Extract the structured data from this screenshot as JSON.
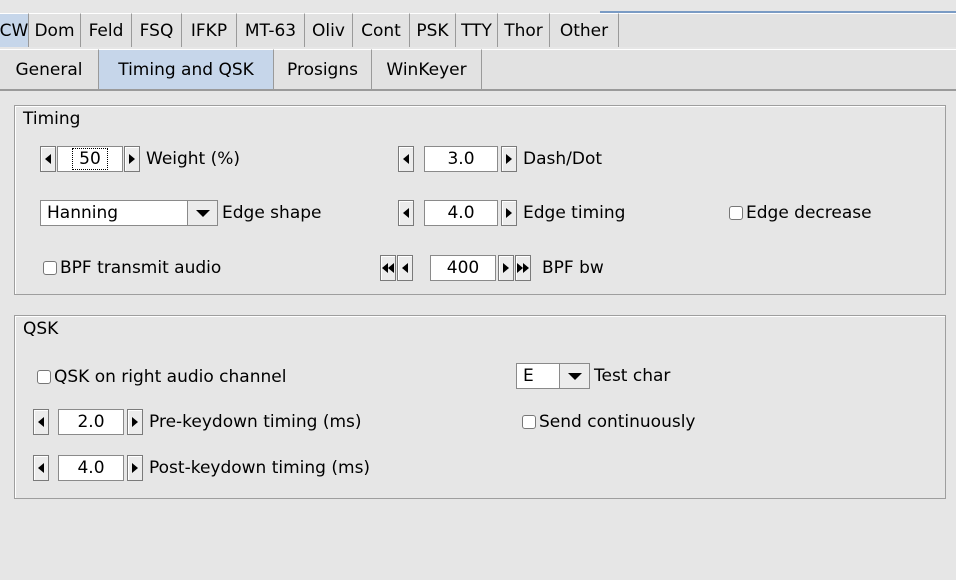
{
  "mode_tabs": [
    "CW",
    "Dom",
    "Feld",
    "FSQ",
    "IFKP",
    "MT-63",
    "Oliv",
    "Cont",
    "PSK",
    "TTY",
    "Thor",
    "Other"
  ],
  "sub_tabs": [
    "General",
    "Timing and QSK",
    "Prosigns",
    "WinKeyer"
  ],
  "timing": {
    "title": "Timing",
    "weight": {
      "value": "50",
      "label": "Weight (%)"
    },
    "dash_dot": {
      "value": "3.0",
      "label": "Dash/Dot"
    },
    "edge_shape": {
      "value": "Hanning",
      "label": "Edge shape"
    },
    "edge_timing": {
      "value": "4.0",
      "label": "Edge timing"
    },
    "edge_decrease": {
      "label": "Edge decrease",
      "checked": false
    },
    "bpf_transmit": {
      "label": "BPF transmit audio",
      "checked": false
    },
    "bpf_bw": {
      "value": "400",
      "label": "BPF bw"
    }
  },
  "qsk": {
    "title": "QSK",
    "right_channel": {
      "label": "QSK on right audio channel",
      "checked": false
    },
    "test_char": {
      "value": "E",
      "label": "Test char"
    },
    "pre_keydown": {
      "value": "2.0",
      "label": "Pre-keydown timing (ms)"
    },
    "send_continuously": {
      "label": "Send continuously",
      "checked": false
    },
    "post_keydown": {
      "value": "4.0",
      "label": "Post-keydown timing (ms)"
    }
  },
  "colors": {
    "active_tab": "#c6d6ea",
    "background": "#e6e6e6"
  }
}
